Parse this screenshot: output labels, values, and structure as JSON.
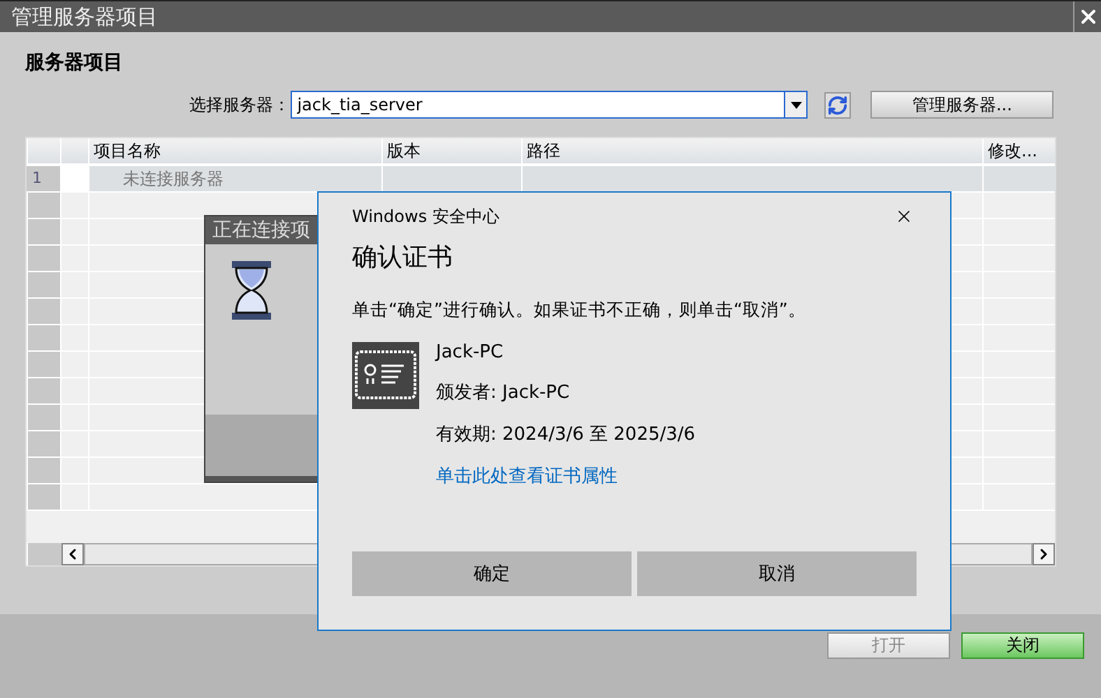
{
  "window": {
    "title": "管理服务器项目"
  },
  "heading": "服务器项目",
  "server_select": {
    "label": "选择服务器：",
    "value": "jack_tia_server"
  },
  "manage_button": "管理服务器...",
  "table": {
    "columns": [
      "项目名称",
      "版本",
      "路径",
      "修改..."
    ],
    "rows": [
      {
        "number": "1",
        "name": "未连接服务器",
        "disabled": true
      }
    ]
  },
  "connecting_dialog": {
    "title": "正在连接项"
  },
  "security_dialog": {
    "caption": "Windows 安全中心",
    "title": "确认证书",
    "message": "单击“确定”进行确认。如果证书不正确，则单击“取消”。",
    "certificate": {
      "name": "Jack-PC",
      "issuer": "颁发者: Jack-PC",
      "validity": "有效期: 2024/3/6 至 2025/3/6"
    },
    "link": "单击此处查看证书属性",
    "buttons": [
      "确定",
      "取消"
    ]
  },
  "footer_buttons": [
    {
      "label": "打开",
      "disabled": true,
      "highlighted": false
    },
    {
      "label": "关闭",
      "disabled": false,
      "highlighted": true
    }
  ]
}
